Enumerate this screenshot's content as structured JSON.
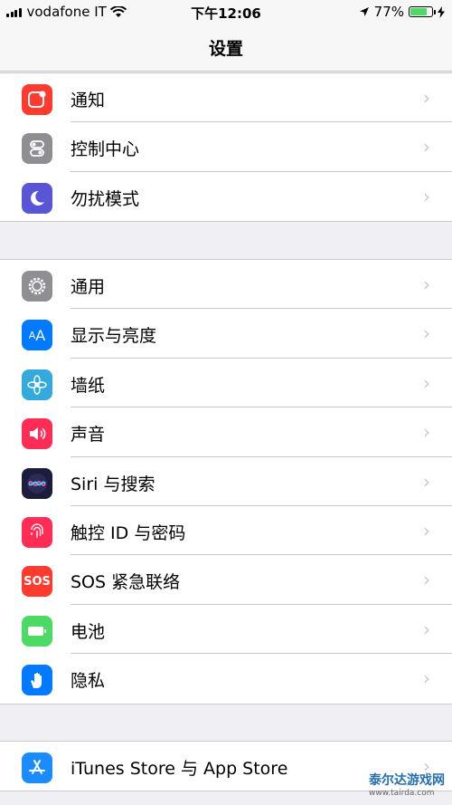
{
  "status_bar": {
    "carrier": "vodafone IT",
    "time": "下午12:06",
    "battery": "77%",
    "battery_level": 0.77
  },
  "nav": {
    "title": "设置"
  },
  "groups": [
    {
      "items": [
        {
          "label": "通知",
          "icon": "notifications-icon",
          "color": "#ff3b30"
        },
        {
          "label": "控制中心",
          "icon": "control-center-icon",
          "color": "#8e8e93"
        },
        {
          "label": "勿扰模式",
          "icon": "do-not-disturb-icon",
          "color": "#5856d6"
        }
      ]
    },
    {
      "items": [
        {
          "label": "通用",
          "icon": "general-gear-icon",
          "color": "#8e8e93"
        },
        {
          "label": "显示与亮度",
          "icon": "display-brightness-icon",
          "color": "#007aff"
        },
        {
          "label": "墙纸",
          "icon": "wallpaper-icon",
          "color": "#34aadc"
        },
        {
          "label": "声音",
          "icon": "sounds-icon",
          "color": "#ff2d55"
        },
        {
          "label": "Siri 与搜索",
          "icon": "siri-icon",
          "color": "#1c1c3c"
        },
        {
          "label": "触控 ID 与密码",
          "icon": "touch-id-icon",
          "color": "#ff2d55"
        },
        {
          "label": "SOS 紧急联络",
          "icon": "sos-icon",
          "color": "#ff3b30",
          "glyph": "SOS"
        },
        {
          "label": "电池",
          "icon": "battery-icon",
          "color": "#4cd964"
        },
        {
          "label": "隐私",
          "icon": "privacy-hand-icon",
          "color": "#007aff"
        }
      ]
    },
    {
      "items": [
        {
          "label": "iTunes Store 与 App Store",
          "icon": "app-store-icon",
          "color": "#007aff"
        }
      ]
    }
  ],
  "watermark": {
    "text": "泰尔达游戏网",
    "url": "www.tairda.com"
  }
}
